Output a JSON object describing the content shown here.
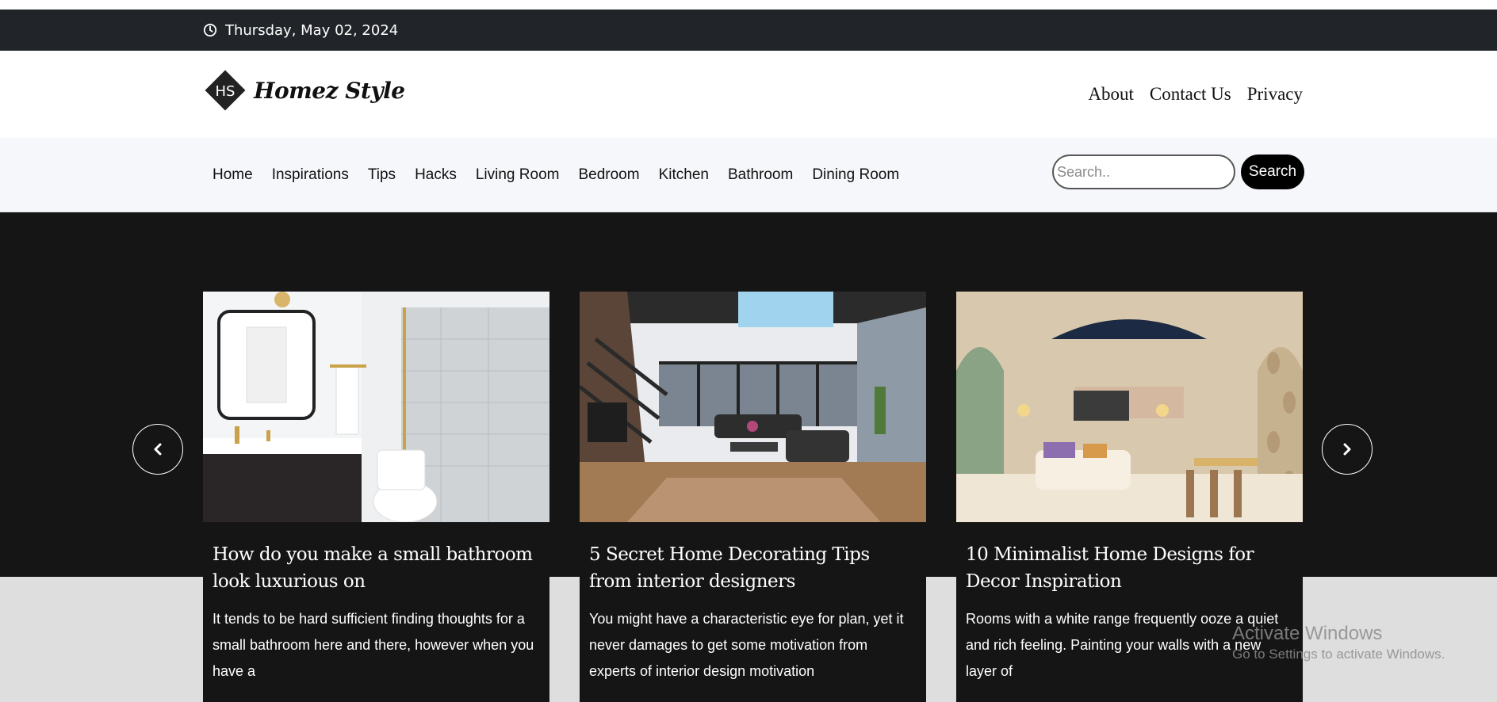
{
  "topbar": {
    "date": "Thursday, May 02, 2024"
  },
  "brand": {
    "name": "Homez Style",
    "mark": "HS"
  },
  "top_links": [
    "About",
    "Contact Us",
    "Privacy"
  ],
  "nav": [
    "Home",
    "Inspirations",
    "Tips",
    "Hacks",
    "Living Room",
    "Bedroom",
    "Kitchen",
    "Bathroom",
    "Dining Room"
  ],
  "search": {
    "placeholder": "Search..",
    "button": "Search"
  },
  "cards": [
    {
      "title": "How do you make a small bathroom look luxurious on",
      "excerpt": "It tends to be hard sufficient finding thoughts for a small bathroom here and there, however when you have a"
    },
    {
      "title": "5 Secret Home Decorating Tips from interior designers",
      "excerpt": "You might have a characteristic eye for plan, yet it never damages to get some motivation from experts of interior design motivation"
    },
    {
      "title": "10 Minimalist Home Designs for Decor Inspiration",
      "excerpt": "Rooms with a white range frequently ooze a quiet and rich feeling. Painting your walls with a new layer of"
    }
  ],
  "watermark": {
    "line1": "Activate Windows",
    "line2": "Go to Settings to activate Windows."
  }
}
